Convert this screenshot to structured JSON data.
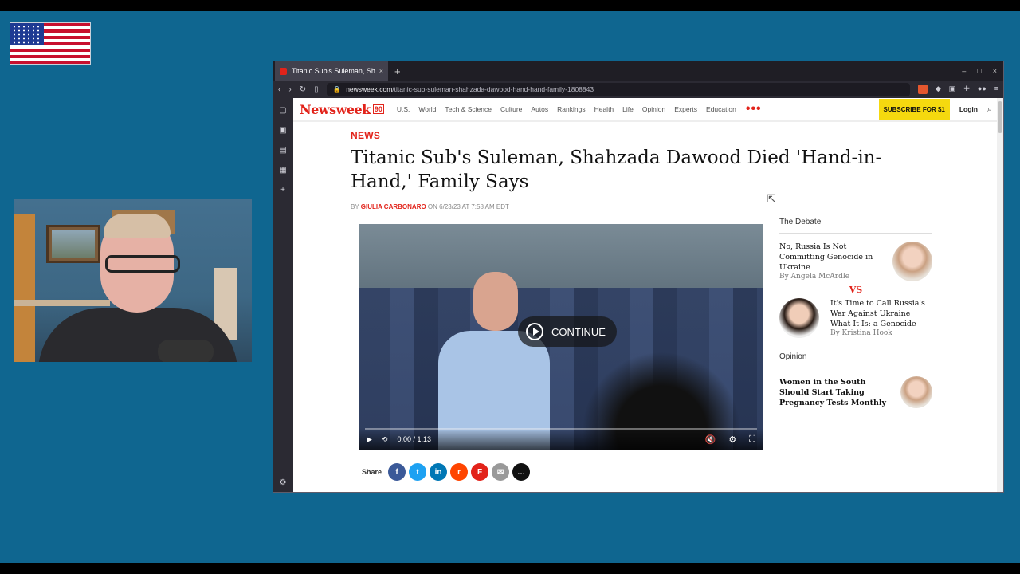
{
  "browser": {
    "tab_title": "Titanic Sub's Suleman, Sh",
    "tab_close": "×",
    "new_tab": "+",
    "url_domain": "newsweek.com",
    "url_path": "/titanic-sub-suleman-shahzada-dawood-hand-hand-family-1808843",
    "window_controls": [
      "–",
      "□",
      "×"
    ]
  },
  "site": {
    "logo": "Newsweek",
    "badge": "90",
    "nav": [
      "U.S.",
      "World",
      "Tech & Science",
      "Culture",
      "Autos",
      "Rankings",
      "Health",
      "Life",
      "Opinion",
      "Experts",
      "Education"
    ],
    "more": "•••",
    "subscribe": "SUBSCRIBE FOR $1",
    "login": "Login"
  },
  "article": {
    "kicker": "NEWS",
    "headline": "Titanic Sub's Suleman, Shahzada Dawood Died 'Hand-in-Hand,' Family Says",
    "by": "BY",
    "author": "GIULIA CARBONARO",
    "date": "ON 6/23/23 AT 7:58 AM EDT"
  },
  "video": {
    "continue": "CONTINUE",
    "time": "0:00 / 1:13",
    "progress": 0
  },
  "share": {
    "label": "Share",
    "buttons": [
      {
        "glyph": "f",
        "color": "#3b5998"
      },
      {
        "glyph": "t",
        "color": "#1da1f2"
      },
      {
        "glyph": "in",
        "color": "#0077b5"
      },
      {
        "glyph": "r",
        "color": "#ff4500"
      },
      {
        "glyph": "F",
        "color": "#e2231a"
      },
      {
        "glyph": "✉",
        "color": "#999999"
      },
      {
        "glyph": "…",
        "color": "#111111"
      }
    ]
  },
  "rail": {
    "debate_title": "The Debate",
    "debate1": {
      "title": "No, Russia Is Not Committing Genocide in Ukraine",
      "by": "By Angela McArdle"
    },
    "vs": "VS",
    "debate2": {
      "title": "It's Time to Call Russia's War Against Ukraine What It Is: a Genocide",
      "by": "By Kristina Hook"
    },
    "opinion_title": "Opinion",
    "opinion1": {
      "title": "Women in the South Should Start Taking Pregnancy Tests Monthly"
    }
  },
  "colors": {
    "brand": "#e2231a",
    "subscribe": "#f5d90f",
    "stage": "#0f6690"
  }
}
